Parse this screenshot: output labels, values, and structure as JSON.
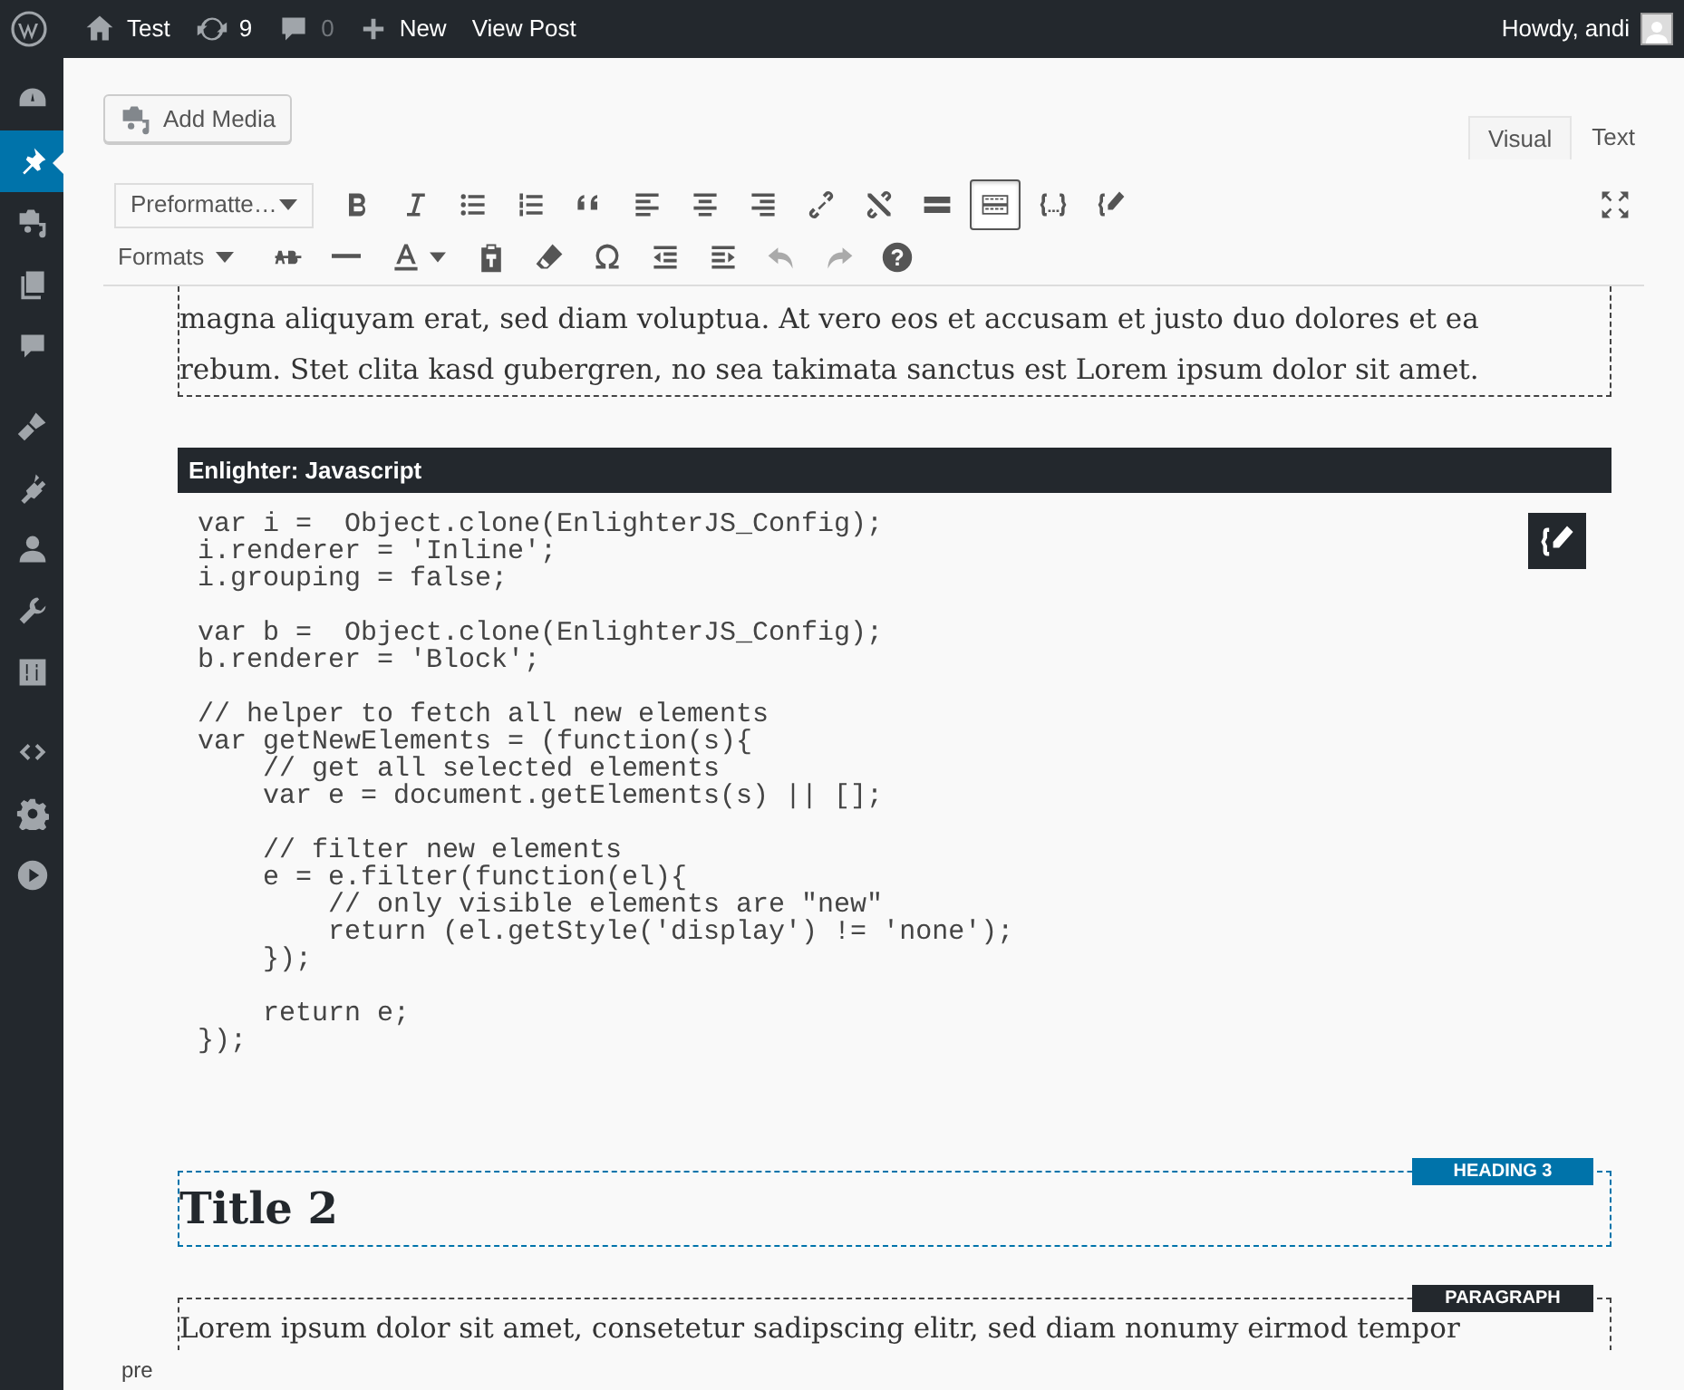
{
  "admin_bar": {
    "items": [
      {
        "kind": "home",
        "label": "Test"
      },
      {
        "kind": "updates",
        "label": "9"
      },
      {
        "kind": "comments",
        "label": "0"
      },
      {
        "kind": "new",
        "label": "New"
      },
      {
        "kind": "plain",
        "label": "View Post"
      }
    ],
    "greeting": "Howdy, andi"
  },
  "sidebar": {
    "items": [
      {
        "kind": "dashboard",
        "selected": false
      },
      {
        "kind": "pin",
        "selected": true
      },
      {
        "kind": "media",
        "selected": false
      },
      {
        "kind": "pages",
        "selected": false
      },
      {
        "kind": "comment",
        "selected": false
      },
      {
        "kind": "brush",
        "selected": false
      },
      {
        "kind": "plug",
        "selected": false
      },
      {
        "kind": "user",
        "selected": false
      },
      {
        "kind": "wrench",
        "selected": false
      },
      {
        "kind": "sliders",
        "selected": false
      },
      {
        "kind": "code",
        "selected": false
      },
      {
        "kind": "gear",
        "selected": false
      },
      {
        "kind": "play",
        "selected": false
      }
    ]
  },
  "editor": {
    "add_media": "Add Media",
    "tabs": [
      {
        "label": "Visual",
        "selected": true
      },
      {
        "label": "Text",
        "selected": false
      }
    ],
    "toolbar_rows": [
      [
        {
          "kind": "dropdown",
          "label": "Preformatte…"
        },
        {
          "kind": "bold",
          "pressed": false,
          "disabled": false
        },
        {
          "kind": "italic",
          "pressed": false,
          "disabled": false
        },
        {
          "kind": "bullets",
          "pressed": false,
          "disabled": false
        },
        {
          "kind": "numbers",
          "pressed": false,
          "disabled": false
        },
        {
          "kind": "quote",
          "pressed": false,
          "disabled": false
        },
        {
          "kind": "left",
          "pressed": false,
          "disabled": false
        },
        {
          "kind": "center",
          "pressed": false,
          "disabled": false
        },
        {
          "kind": "right",
          "pressed": false,
          "disabled": false
        },
        {
          "kind": "link",
          "pressed": false,
          "disabled": false
        },
        {
          "kind": "unlink",
          "pressed": false,
          "disabled": false
        },
        {
          "kind": "more",
          "pressed": false,
          "disabled": false
        },
        {
          "kind": "keyboard",
          "pressed": true,
          "disabled": false
        },
        {
          "kind": "braces",
          "pressed": false,
          "disabled": false
        },
        {
          "kind": "bracepen",
          "pressed": false,
          "disabled": false
        }
      ],
      [
        {
          "kind": "dropdown",
          "label": "Formats"
        },
        {
          "kind": "strike",
          "pressed": false,
          "disabled": false
        },
        {
          "kind": "hr",
          "pressed": false,
          "disabled": false
        },
        {
          "kind": "color",
          "pressed": false,
          "disabled": false
        },
        {
          "kind": "paste",
          "pressed": false,
          "disabled": false
        },
        {
          "kind": "eraser",
          "pressed": false,
          "disabled": false
        },
        {
          "kind": "omega",
          "pressed": false,
          "disabled": false
        },
        {
          "kind": "outdent",
          "pressed": false,
          "disabled": false
        },
        {
          "kind": "indent",
          "pressed": false,
          "disabled": false
        },
        {
          "kind": "undo",
          "pressed": false,
          "disabled": true
        },
        {
          "kind": "redo",
          "pressed": false,
          "disabled": true
        },
        {
          "kind": "help",
          "pressed": false,
          "disabled": false
        }
      ]
    ],
    "blocks": [
      {
        "kind": "paragraph",
        "lines": [
          "magna aliquyam erat, sed diam voluptua. At vero eos et accusam et justo duo dolores et ea",
          "rebum. Stet clita kasd gubergren, no sea takimata sanctus est Lorem ipsum dolor sit amet."
        ]
      },
      {
        "kind": "code",
        "title": "Enlighter: Javascript",
        "code": "var i =  Object.clone(EnlighterJS_Config);\ni.renderer = 'Inline';\ni.grouping = false;\n\nvar b =  Object.clone(EnlighterJS_Config);\nb.renderer = 'Block';\n\n// helper to fetch all new elements\nvar getNewElements = (function(s){\n    // get all selected elements\n    var e = document.getElements(s) || [];\n\n    // filter new elements\n    e = e.filter(function(el){\n        // only visible elements are \"new\"\n        return (el.getStyle('display') != 'none');\n    });\n\n    return e;\n});"
      },
      {
        "kind": "heading",
        "badge": "HEADING 3",
        "text": "Title 2"
      },
      {
        "kind": "labeled_paragraph",
        "badge": "PARAGRAPH",
        "lines": [
          "Lorem ipsum dolor sit amet, consetetur sadipscing elitr, sed diam nonumy eirmod tempor"
        ]
      }
    ],
    "status_path": "pre"
  }
}
